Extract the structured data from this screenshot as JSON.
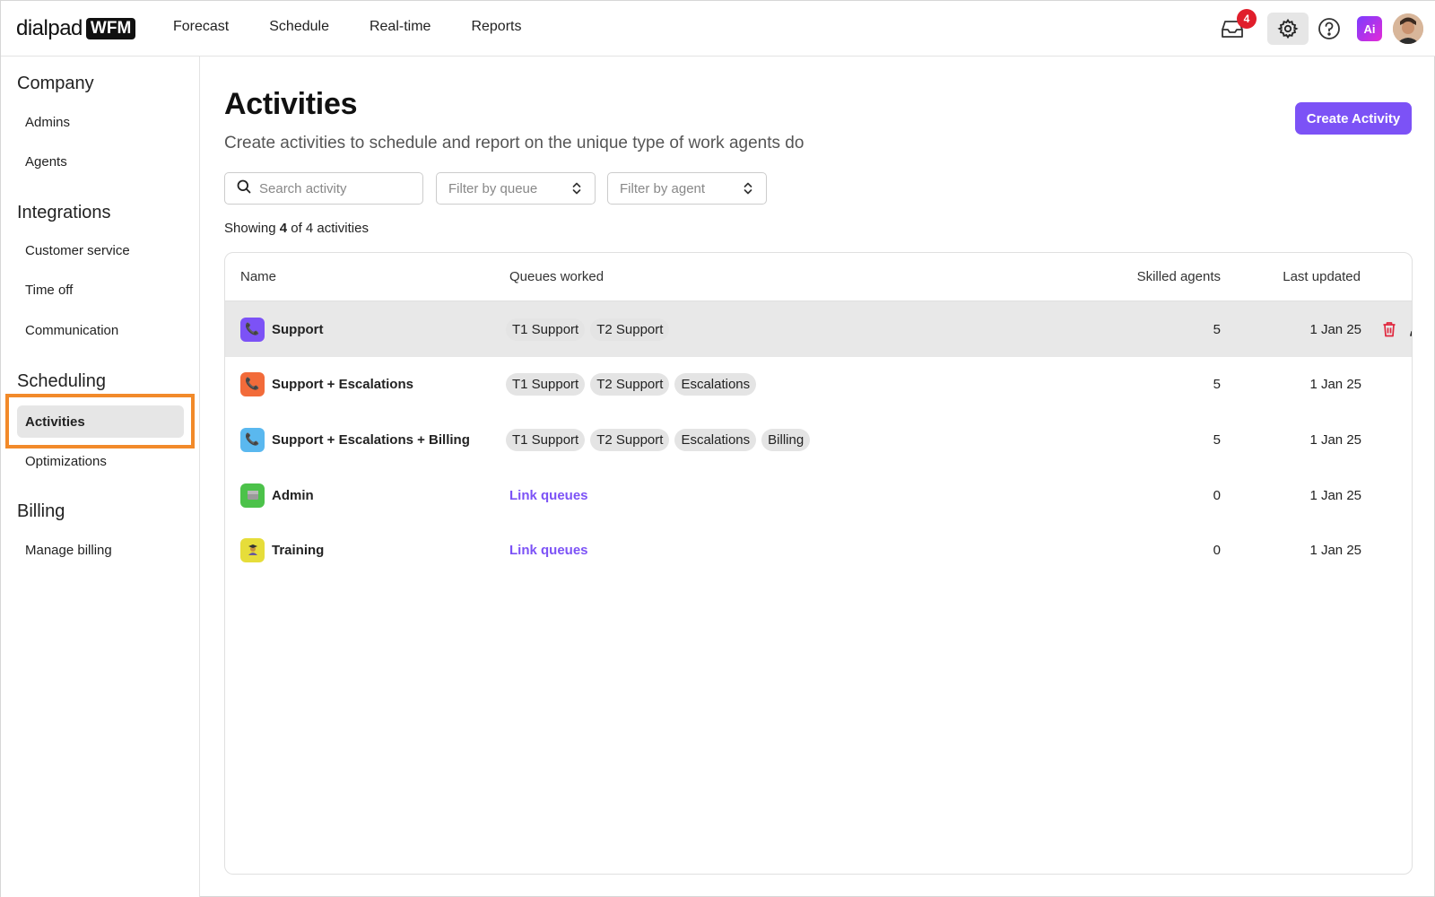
{
  "header": {
    "logo_text": "dialpad",
    "logo_badge": "WFM",
    "nav": [
      "Forecast",
      "Schedule",
      "Real-time",
      "Reports"
    ],
    "inbox_count": "4",
    "ai_label": "Ai"
  },
  "sidebar": {
    "sections": [
      {
        "title": "Company",
        "items": [
          "Admins",
          "Agents"
        ]
      },
      {
        "title": "Integrations",
        "items": [
          "Customer service",
          "Time off",
          "Communication"
        ]
      },
      {
        "title": "Scheduling",
        "items": [
          "Activities",
          "Optimizations"
        ]
      },
      {
        "title": "Billing",
        "items": [
          "Manage billing"
        ]
      }
    ],
    "active_item": "Activities"
  },
  "page": {
    "title": "Activities",
    "subtitle": "Create activities to schedule and report on the unique type of work agents do",
    "create_label": "Create Activity",
    "search_placeholder": "Search activity",
    "filter_queue": "Filter by queue",
    "filter_agent": "Filter by agent",
    "showing_prefix": "Showing",
    "showing_count": "4",
    "showing_suffix": "of 4 activities"
  },
  "table": {
    "headers": {
      "name": "Name",
      "queues": "Queues worked",
      "skilled": "Skilled agents",
      "updated": "Last updated"
    },
    "rows": [
      {
        "name": "Support",
        "icon": "phone-icon",
        "color": "#7c52f6",
        "queues": [
          "T1 Support",
          "T2 Support"
        ],
        "skilled": "5",
        "updated": "1 Jan 25",
        "selected": true
      },
      {
        "name": "Support + Escalations",
        "icon": "phone-icon",
        "color": "#f26b3a",
        "queues": [
          "T1 Support",
          "T2 Support",
          "Escalations"
        ],
        "skilled": "5",
        "updated": "1 Jan 25"
      },
      {
        "name": "Support + Escalations + Billing",
        "icon": "phone-icon",
        "color": "#5ab8ef",
        "queues": [
          "T1 Support",
          "T2 Support",
          "Escalations",
          "Billing"
        ],
        "skilled": "5",
        "updated": "1 Jan 25"
      },
      {
        "name": "Admin",
        "icon": "folder-icon",
        "color": "#4cc24a",
        "link": "Link queues",
        "skilled": "0",
        "updated": "1 Jan 25"
      },
      {
        "name": "Training",
        "icon": "training-icon",
        "color": "#e6dd3a",
        "link": "Link queues",
        "skilled": "0",
        "updated": "1 Jan 25"
      }
    ]
  }
}
